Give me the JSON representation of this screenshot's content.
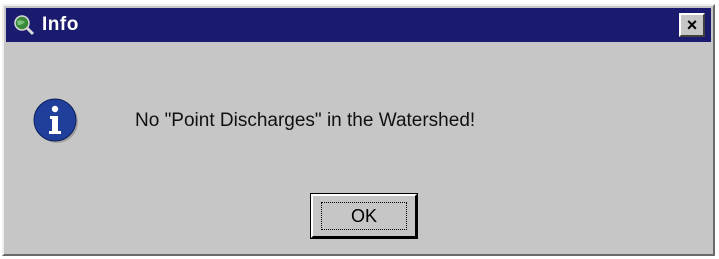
{
  "window": {
    "title": "Info",
    "icon": "globe-magnifier-icon",
    "close_label": "×"
  },
  "body": {
    "icon": "info-icon",
    "message": "No \"Point Discharges\" in the Watershed!"
  },
  "buttons": {
    "ok_label": "OK"
  },
  "colors": {
    "titlebar": "#1a1a6e",
    "dialog_bg": "#c6c6c6",
    "info_icon_fill": "#1f3f9a"
  }
}
